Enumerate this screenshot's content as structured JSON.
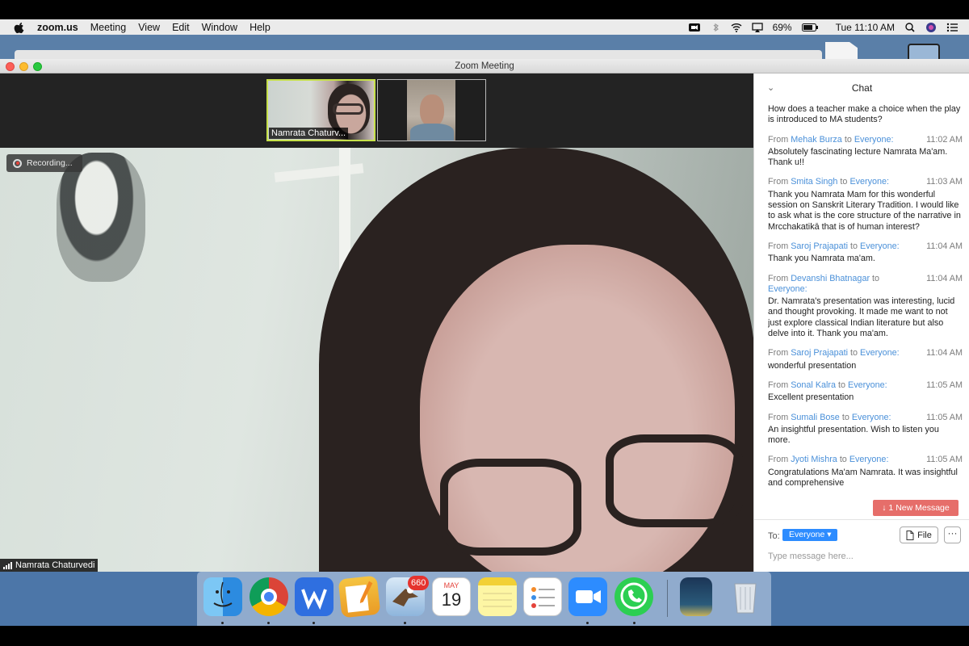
{
  "menubar": {
    "app": "zoom.us",
    "items": [
      "Meeting",
      "View",
      "Edit",
      "Window",
      "Help"
    ],
    "battery": "69%",
    "clock": "Tue 11:10 AM"
  },
  "window": {
    "title": "Zoom Meeting"
  },
  "thumbnails": {
    "first_label": "Namrata Chaturv..."
  },
  "video": {
    "recording_label": "Recording...",
    "speaker_name": "Namrata Chaturvedi"
  },
  "chat": {
    "title": "Chat",
    "messages": [
      {
        "from": "",
        "to": "",
        "time": "",
        "text": "How does a teacher make a choice when the play is introduced to MA students?"
      },
      {
        "from": "Mehak Burza",
        "to": "Everyone:",
        "time": "11:02 AM",
        "text": "Absolutely fascinating lecture Namrata Ma'am. Thank u!!"
      },
      {
        "from": "Smita Singh",
        "to": "Everyone:",
        "time": "11:03 AM",
        "text": "Thank you Namrata Mam for this wonderful session on Sanskrit Literary Tradition. I would like to ask what is the core structure of the narrative in Mrcchakatikā that is of human interest?"
      },
      {
        "from": "Saroj Prajapati",
        "to": "Everyone:",
        "time": "11:04 AM",
        "text": "Thank you Namrata ma'am."
      },
      {
        "from": "Devanshi Bhatnagar",
        "to": "Everyone:",
        "time": "11:04 AM",
        "text": "Dr. Namrata's presentation was interesting, lucid and thought provoking. It made me want to not just explore classical Indian literature but also delve into it. Thank you ma'am."
      },
      {
        "from": "Saroj Prajapati",
        "to": "Everyone:",
        "time": "11:04 AM",
        "text": "wonderful presentation"
      },
      {
        "from": "Sonal Kalra",
        "to": "Everyone:",
        "time": "11:05 AM",
        "text": "Excellent presentation"
      },
      {
        "from": "Sumali Bose",
        "to": "Everyone:",
        "time": "11:05 AM",
        "text": "An insightful presentation. Wish to listen you more."
      },
      {
        "from": "Jyoti Mishra",
        "to": "Everyone:",
        "time": "11:05 AM",
        "text": "Congratulations Ma'am Namrata. It was insightful and comprehensive"
      }
    ],
    "from_prefix": "From",
    "to_word": "to",
    "new_message": "↓ 1 New Message",
    "to_label": "To:",
    "recipient": "Everyone ▾",
    "file_button": "File",
    "more_button": "···",
    "input_placeholder": "Type message here..."
  },
  "dock": {
    "mail_badge": "660",
    "calendar_month": "MAY",
    "calendar_day": "19",
    "items": [
      "finder-icon",
      "chrome-icon",
      "wps-icon",
      "pages-icon",
      "mail-icon",
      "calendar-icon",
      "notes-icon",
      "reminders-icon",
      "zoom-icon",
      "whatsapp-icon",
      "book-icon",
      "trash-icon"
    ]
  },
  "colors": {
    "accent": "#2d8cff",
    "chat_name": "#4a90d9",
    "new_message_bg": "#e66e6a",
    "active_speaker_border": "#c6e04a"
  }
}
